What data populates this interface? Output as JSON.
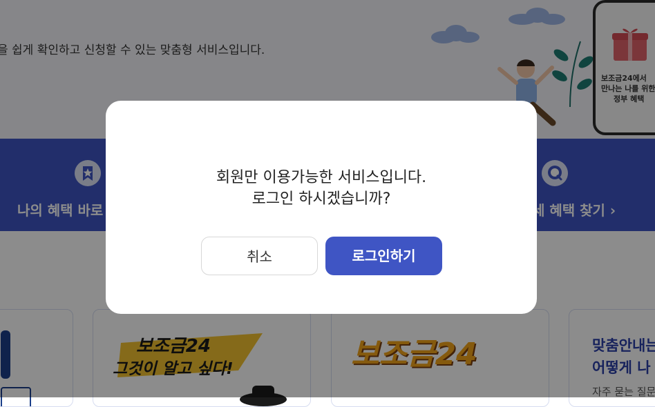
{
  "hero": {
    "description": "을 쉽게 확인하고 신청할 수 있는 맞춤형 서비스입니다.",
    "phone_text_lines": [
      "보조금24에서",
      "만나는 나를 위한",
      "정부 혜택"
    ]
  },
  "quick_menu": {
    "left_label": "나의 혜택 바로",
    "right_label": "세 혜택 찾기 ›"
  },
  "cards": {
    "card2_line1": "보조금24",
    "card2_line2": "그것이 알고 싶다!",
    "card3_title": "보조금24",
    "card4_line1": "맞춤안내는",
    "card4_line2": "어떻게 나",
    "card4_line3": "자주 묻는 질문"
  },
  "modal": {
    "message_line1": "회원만 이용가능한 서비스입니다.",
    "message_line2": "로그인 하시겠습니까?",
    "cancel_label": "취소",
    "login_label": "로그인하기"
  },
  "colors": {
    "accent": "#3f55c4",
    "overlay": "rgba(0,0,0,0.45)"
  }
}
